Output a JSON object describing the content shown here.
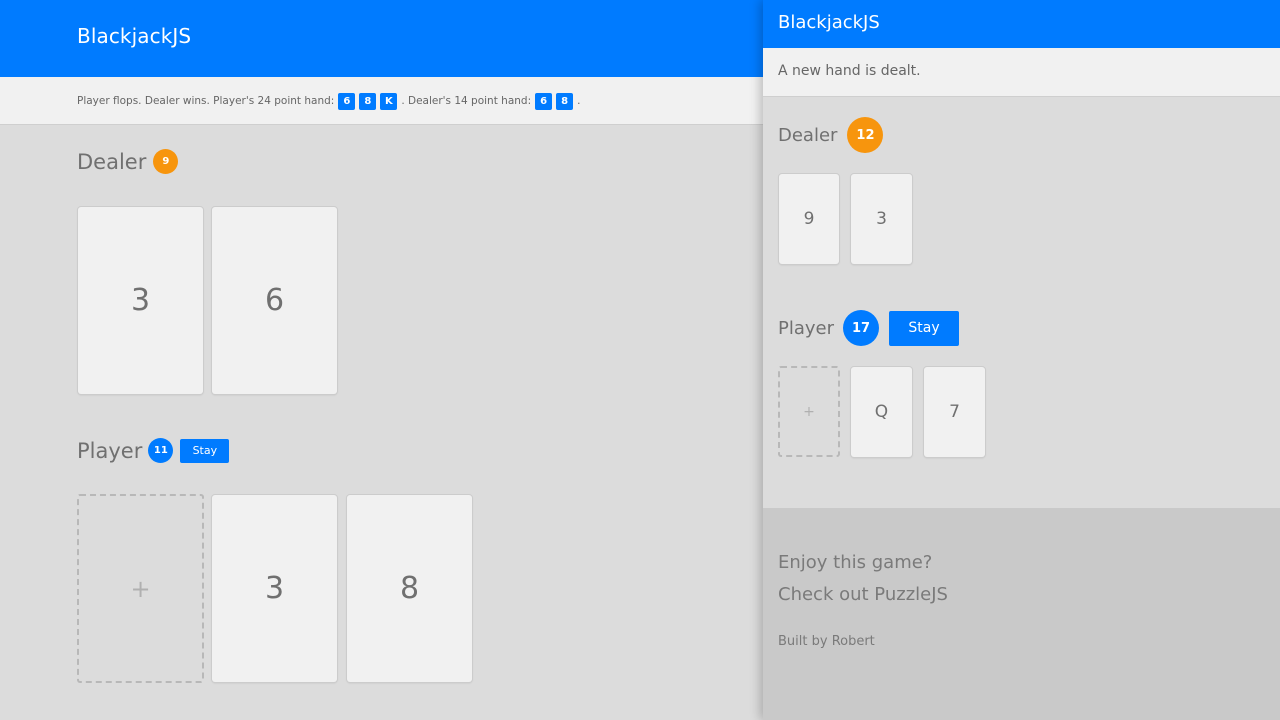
{
  "app": {
    "title": "BlackjackJS"
  },
  "main": {
    "status": {
      "prefix": "Player flops. Dealer wins. Player's 24 point hand:",
      "player_cards": [
        "6",
        "8",
        "K"
      ],
      "middle": ". Dealer's 14 point hand:",
      "dealer_cards": [
        "6",
        "8"
      ],
      "suffix": "."
    },
    "dealer": {
      "label": "Dealer",
      "score": "9",
      "cards": [
        "3",
        "6"
      ]
    },
    "player": {
      "label": "Player",
      "score": "11",
      "stay_label": "Stay",
      "add_symbol": "+",
      "cards": [
        "3",
        "8"
      ]
    }
  },
  "panel": {
    "status": "A new hand is dealt.",
    "dealer": {
      "label": "Dealer",
      "score": "12",
      "cards": [
        "9",
        "3"
      ]
    },
    "player": {
      "label": "Player",
      "score": "17",
      "stay_label": "Stay",
      "add_symbol": "+",
      "cards": [
        "Q",
        "7"
      ]
    },
    "footer": {
      "promo_line1": "Enjoy this game?",
      "promo_line2": "Check out PuzzleJS",
      "credit": "Built by Robert"
    }
  },
  "colors": {
    "accent": "#007bff",
    "score_dealer": "#f7950d",
    "card_bg": "#f1f1f1"
  }
}
